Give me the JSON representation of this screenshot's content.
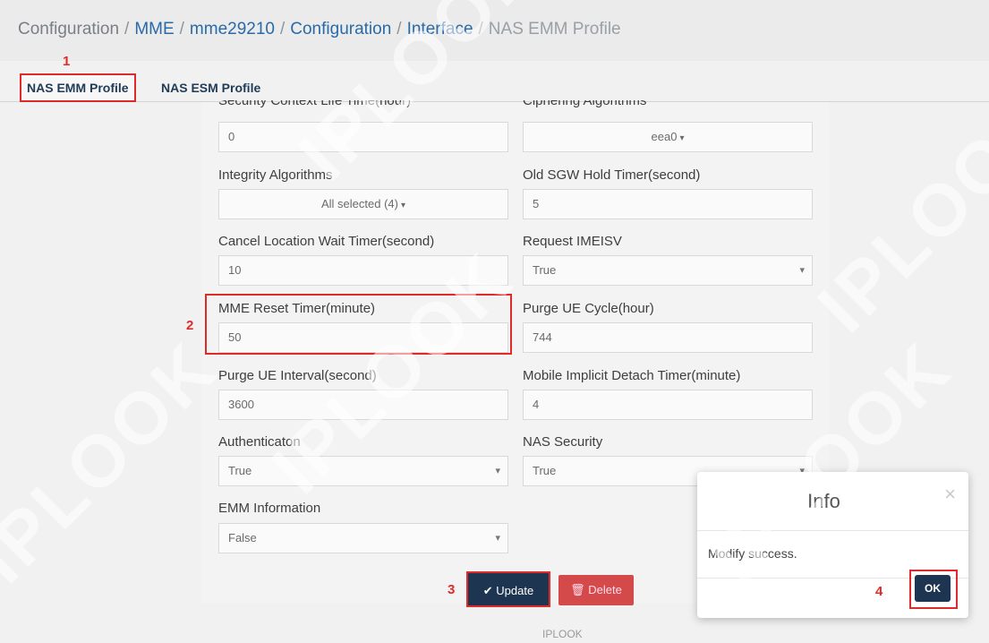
{
  "breadcrumb": {
    "items": [
      "Configuration",
      "MME",
      "mme29210",
      "Configuration",
      "Interface",
      "NAS EMM Profile"
    ],
    "separator": "/"
  },
  "tabs": [
    "NAS EMM Profile",
    "NAS ESM Profile"
  ],
  "annotations": [
    "1",
    "2",
    "3",
    "4"
  ],
  "form": {
    "security_context_label": "Security Context Life Time(hour)",
    "security_context_value": "0",
    "ciphering_label": "Ciphering Algorithms",
    "ciphering_value": "eea0",
    "integrity_label": "Integrity Algorithms",
    "integrity_value": "All selected (4)",
    "old_sgw_label": "Old SGW Hold Timer(second)",
    "old_sgw_value": "5",
    "cancel_location_label": "Cancel Location Wait Timer(second)",
    "cancel_location_value": "10",
    "request_imeisv_label": "Request IMEISV",
    "request_imeisv_value": "True",
    "mme_reset_label": "MME Reset Timer(minute)",
    "mme_reset_value": "50",
    "purge_cycle_label": "Purge UE Cycle(hour)",
    "purge_cycle_value": "744",
    "purge_interval_label": "Purge UE Interval(second)",
    "purge_interval_value": "3600",
    "mobile_detach_label": "Mobile Implicit Detach Timer(minute)",
    "mobile_detach_value": "4",
    "authentication_label": "Authenticaton",
    "authentication_value": "True",
    "nas_security_label": "NAS Security",
    "nas_security_value": "True",
    "emm_info_label": "EMM Information",
    "emm_info_value": "False"
  },
  "buttons": {
    "update": "Update",
    "delete": "Delete"
  },
  "footer": "IPLOOK",
  "modal": {
    "title": "Info",
    "close": "×",
    "message": "Modify success.",
    "ok": "OK"
  },
  "colors": {
    "primary": "#1d3550",
    "danger": "#d44a4a",
    "annotation": "#e02a2a",
    "link": "#2a6aa8"
  },
  "watermark": "IPLOOK"
}
